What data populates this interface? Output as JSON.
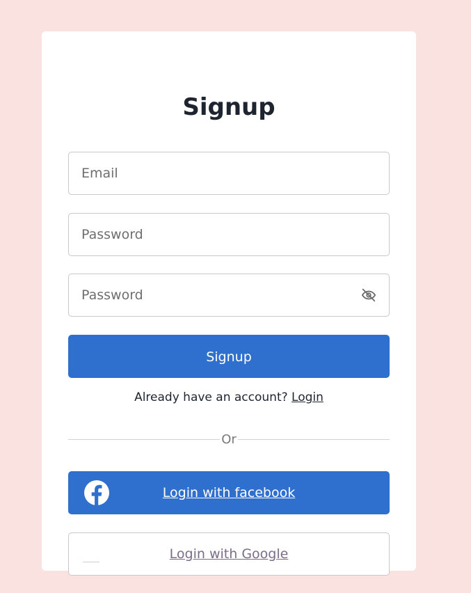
{
  "page": {
    "title": "Signup"
  },
  "form": {
    "email": {
      "placeholder": "Email",
      "value": ""
    },
    "password": {
      "placeholder": "Password",
      "value": ""
    },
    "confirm_password": {
      "placeholder": "Password",
      "value": ""
    },
    "submit_label": "Signup"
  },
  "login_prompt": {
    "text": "Already have an account? ",
    "link_label": "Login"
  },
  "divider_label": "Or",
  "social": {
    "facebook_label": "Login with facebook",
    "google_label": "Login with Google"
  },
  "colors": {
    "background": "#f9e2e0",
    "primary": "#2f6fce",
    "google_text": "#7b6c87"
  },
  "icons": {
    "password_toggle": "eye-off-icon",
    "facebook": "facebook-icon",
    "google": "google-icon"
  }
}
